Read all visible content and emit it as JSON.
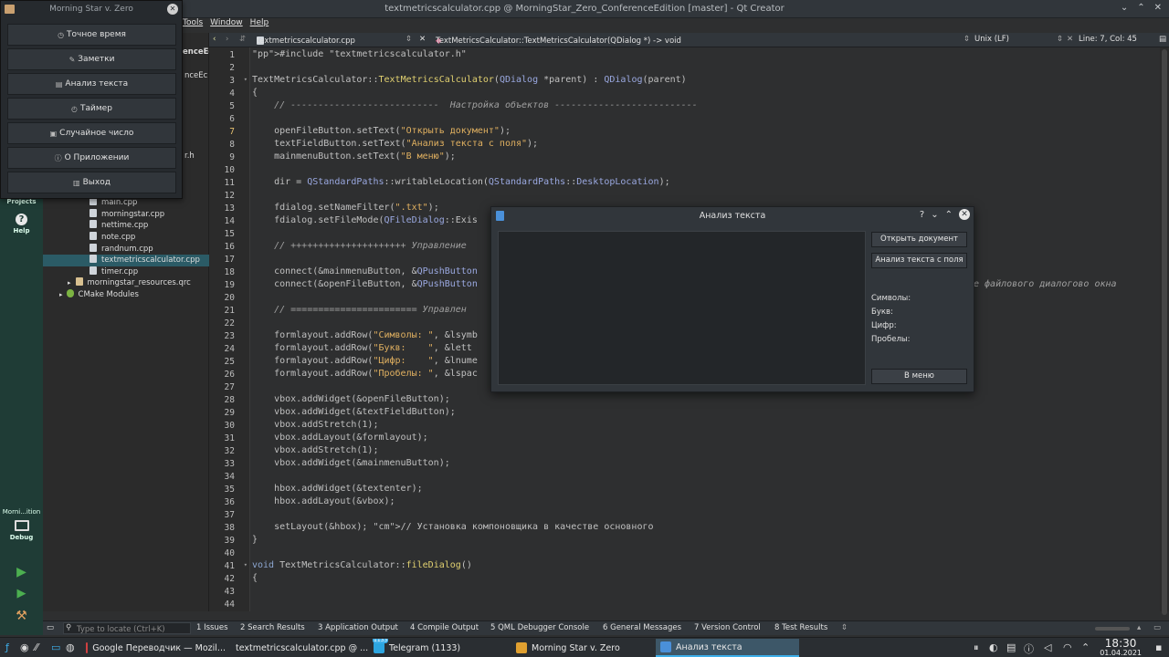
{
  "window": {
    "title": "textmetricscalculator.cpp @ MorningStar_Zero_ConferenceEdition [master] - Qt Creator"
  },
  "menubar": {
    "items": [
      "Tools",
      "Window",
      "Help"
    ]
  },
  "modebar": {
    "projects": "Projects",
    "help": "Help",
    "target": "Morni...ition",
    "debug": "Debug"
  },
  "tree": {
    "frag1": "enceEd",
    "frag2": "nceEc",
    "frag3": "r.h",
    "items": [
      "main.cpp",
      "morningstar.cpp",
      "nettime.cpp",
      "note.cpp",
      "randnum.cpp",
      "textmetricscalculator.cpp",
      "timer.cpp",
      "morningstar_resources.qrc",
      "CMake Modules"
    ]
  },
  "editor_toolbar": {
    "file": "textmetricscalculator.cpp",
    "symbol": "TextMetricsCalculator::TextMetricsCalculator(QDialog *) -> void",
    "eol": "Unix (LF)",
    "position": "Line: 7, Col: 45"
  },
  "code": {
    "lines": [
      "#include \"textmetricscalculator.h\"",
      "",
      "TextMetricsCalculator::TextMetricsCalculator(QDialog *parent) : QDialog(parent)",
      "{",
      "    // ---------------------------  Настройка объектов --------------------------",
      "",
      "    openFileButton.setText(\"Открыть документ\");",
      "    textFieldButton.setText(\"Анализ текста с поля\");",
      "    mainmenuButton.setText(\"В меню\");",
      "",
      "    dir = QStandardPaths::writableLocation(QStandardPaths::DesktopLocation);",
      "",
      "    fdialog.setNameFilter(\".txt\");",
      "    fdialog.setFileMode(QFileDialog::Exis",
      "",
      "    // +++++++++++++++++++++ Управление",
      "",
      "    connect(&mainmenuButton, &QPushButton",
      "    connect(&openFileButton, &QPushButton",
      "",
      "    // ======================= Управлен",
      "",
      "    formlayout.addRow(\"Символы: \", &lsymb",
      "    formlayout.addRow(\"Букв:    \", &lett",
      "    formlayout.addRow(\"Цифр:    \", &lnume",
      "    formlayout.addRow(\"Пробелы: \", &lspac",
      "",
      "    vbox.addWidget(&openFileButton);",
      "    vbox.addWidget(&textFieldButton);",
      "    vbox.addStretch(1);",
      "    vbox.addLayout(&formlayout);",
      "    vbox.addStretch(1);",
      "    vbox.addWidget(&mainmenuButton);",
      "",
      "    hbox.addWidget(&textenter);",
      "    hbox.addLayout(&vbox);",
      "",
      "    setLayout(&hbox); // Установка компоновщика в качестве основного",
      "}",
      "",
      "void TextMetricsCalculator::fileDialog()",
      "{",
      "",
      ""
    ],
    "line19_tail": "е файлового диалогово окна"
  },
  "popup": {
    "title": "Morning Star v. Zero",
    "items": [
      {
        "icon": "clock-icon",
        "glyph": "◷",
        "label": "Точное время"
      },
      {
        "icon": "note-icon",
        "glyph": "✎",
        "label": "Заметки"
      },
      {
        "icon": "text-analysis-icon",
        "glyph": "▤",
        "label": "Анализ текста"
      },
      {
        "icon": "timer-icon",
        "glyph": "◴",
        "label": "Таймер"
      },
      {
        "icon": "dice-icon",
        "glyph": "▣",
        "label": "Случайное число"
      },
      {
        "icon": "info-icon",
        "glyph": "ⓘ",
        "label": "О Приложении"
      },
      {
        "icon": "exit-icon",
        "glyph": "▥",
        "label": "Выход"
      }
    ]
  },
  "dialog": {
    "title": "Анализ текста",
    "open_doc": "Открыть документ",
    "analyze_field": "Анализ текста с поля",
    "labels": [
      "Символы:",
      "Букв:",
      "Цифр:",
      "Пробелы:"
    ],
    "menu_button": "В меню"
  },
  "outbar": {
    "locate_placeholder": "Type to locate (Ctrl+K)",
    "tabs": [
      "1 Issues",
      "2 Search Results",
      "3 Application Output",
      "4 Compile Output",
      "5 QML Debugger Console",
      "6 General Messages",
      "7 Version Control",
      "8 Test Results"
    ]
  },
  "taskbar": {
    "tasks": [
      {
        "label": "Google Переводчик — Mozil...",
        "color": "#d04040"
      },
      {
        "label": "textmetricscalculator.cpp @ ...",
        "color": "#41cd52"
      },
      {
        "label": "Telegram (1133)",
        "color": "#2ca5e0"
      },
      {
        "label": "Morning Star v. Zero",
        "color": "#e0a030"
      },
      {
        "label": "Анализ текста",
        "color": "#4a90d9"
      }
    ],
    "telegram_badge": "1133",
    "time": "18:30",
    "date": "01.04.2021"
  }
}
